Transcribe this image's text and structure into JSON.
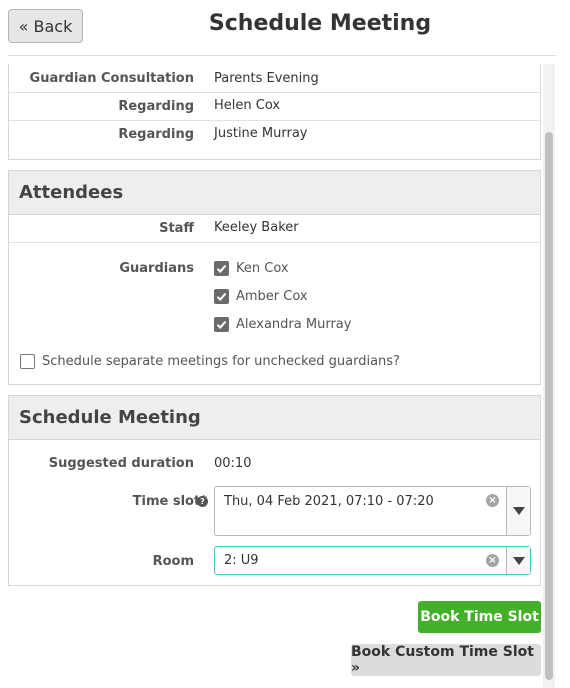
{
  "header": {
    "back_label": "« Back",
    "title": "Schedule Meeting"
  },
  "details": {
    "rows": [
      {
        "label": "Guardian Consultation",
        "value": "Parents Evening"
      },
      {
        "label": "Regarding",
        "value": "Helen Cox"
      },
      {
        "label": "Regarding",
        "value": "Justine Murray"
      }
    ]
  },
  "attendees": {
    "title": "Attendees",
    "staff_label": "Staff",
    "staff_value": "Keeley Baker",
    "guardians_label": "Guardians",
    "guardians": [
      {
        "name": "Ken Cox",
        "checked": true
      },
      {
        "name": "Amber Cox",
        "checked": true
      },
      {
        "name": "Alexandra Murray",
        "checked": true
      }
    ],
    "separate_label": "Schedule separate meetings for unchecked guardians?",
    "separate_checked": false
  },
  "schedule": {
    "title": "Schedule Meeting",
    "duration_label": "Suggested duration",
    "duration_value": "00:10",
    "timeslot_label": "Time slot*",
    "timeslot_value": "Thu, 04 Feb 2021, 07:10 - 07:20",
    "room_label": "Room",
    "room_value": "2: U9",
    "room_focus_color": "#4ac7c7"
  },
  "actions": {
    "book_label": "Book Time Slot",
    "custom_label": "Book Custom Time Slot »",
    "book_color": "#43b02a"
  },
  "icons": {
    "help": "question-circle-icon",
    "clear": "clear-x-icon",
    "caret": "caret-down-icon",
    "check": "check-icon"
  }
}
